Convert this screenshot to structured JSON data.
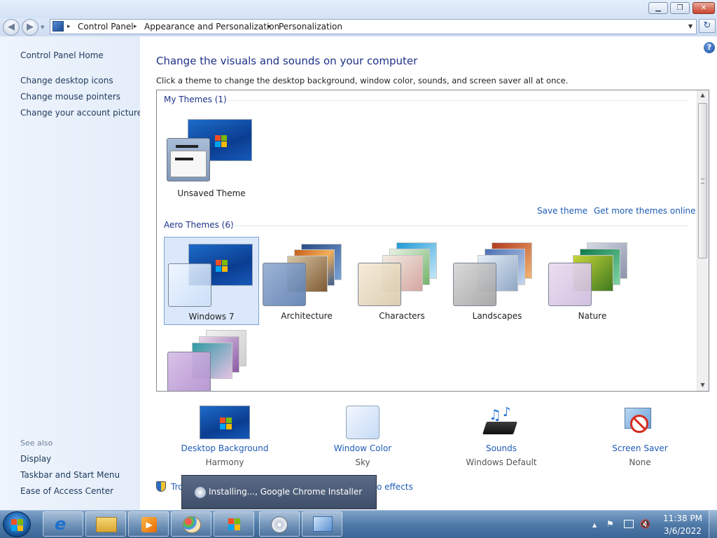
{
  "window": {
    "minimize": "▁",
    "maximize": "❐",
    "close": "✕"
  },
  "address": {
    "breadcrumbs": [
      "Control Panel",
      "Appearance and Personalization",
      "Personalization"
    ],
    "separator": "▸",
    "dropdown": "▼",
    "refresh": "↻",
    "back": "◀",
    "forward": "▶"
  },
  "sidebar": {
    "home": "Control Panel Home",
    "tasks": [
      "Change desktop icons",
      "Change mouse pointers",
      "Change your account picture"
    ],
    "see_also_label": "See also",
    "see_also": [
      "Display",
      "Taskbar and Start Menu",
      "Ease of Access Center"
    ]
  },
  "main": {
    "heading": "Change the visuals and sounds on your computer",
    "subheading": "Click a theme to change the desktop background, window color, sounds, and screen saver all at once.",
    "help": "?"
  },
  "themes": {
    "my_group": "My Themes (1)",
    "my_items": [
      "Unsaved Theme"
    ],
    "save_theme": "Save theme",
    "get_more": "Get more themes online",
    "aero_group": "Aero Themes (6)",
    "aero_items": [
      "Windows 7",
      "Architecture",
      "Characters",
      "Landscapes",
      "Nature"
    ],
    "selected": "Windows 7"
  },
  "settings": [
    {
      "label": "Desktop Background",
      "value": "Harmony",
      "icon": "desktop-background-icon"
    },
    {
      "label": "Window Color",
      "value": "Sky",
      "icon": "window-color-icon"
    },
    {
      "label": "Sounds",
      "value": "Windows Default",
      "icon": "sounds-icon"
    },
    {
      "label": "Screen Saver",
      "value": "None",
      "icon": "screen-saver-icon"
    }
  ],
  "footer": {
    "troubleshoot_prefix": "Tro",
    "troubleshoot_suffix": "o effects"
  },
  "toast": {
    "text": "Installing..., Google Chrome Installer"
  },
  "taskbar": {
    "time": "11:38 PM",
    "date": "3/6/2022",
    "show_hidden": "▲"
  },
  "colors": {
    "link": "#1e5bb6",
    "heading": "#1e3287",
    "selection": "#dbe8fb"
  }
}
